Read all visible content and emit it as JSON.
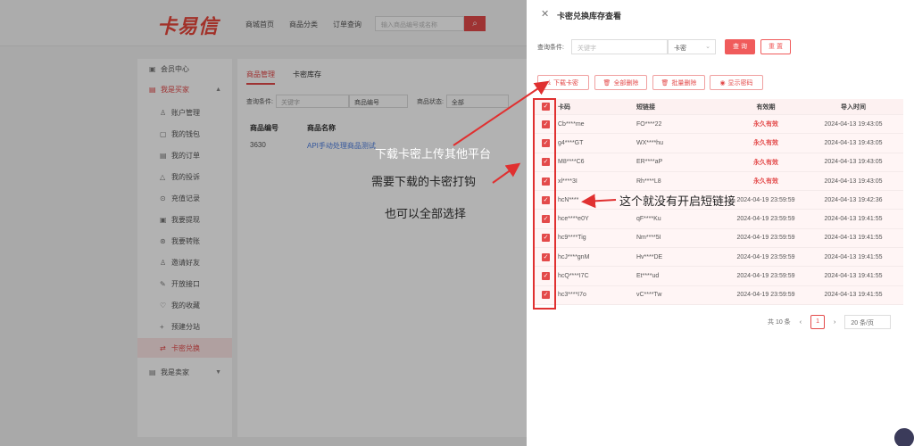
{
  "header": {
    "logo_text": "卡易信",
    "nav": [
      "商城首页",
      "商品分类",
      "订单查询"
    ],
    "search_placeholder": "输入商品编号或名称"
  },
  "sidebar": {
    "items": [
      {
        "label": "会员中心",
        "icon": "home-icon"
      },
      {
        "label": "我是买家",
        "icon": "buyer-icon"
      },
      {
        "label": "账户管理",
        "icon": "user-icon"
      },
      {
        "label": "我的钱包",
        "icon": "wallet-icon"
      },
      {
        "label": "我的订单",
        "icon": "order-icon"
      },
      {
        "label": "我的投诉",
        "icon": "warning-icon"
      },
      {
        "label": "充值记录",
        "icon": "recharge-icon"
      },
      {
        "label": "我要提现",
        "icon": "withdraw-icon"
      },
      {
        "label": "我要转账",
        "icon": "transfer-icon"
      },
      {
        "label": "邀请好友",
        "icon": "invite-icon"
      },
      {
        "label": "开放接口",
        "icon": "api-icon"
      },
      {
        "label": "我的收藏",
        "icon": "heart-icon"
      },
      {
        "label": "预建分站",
        "icon": "plus-icon"
      },
      {
        "label": "卡密兑换",
        "icon": "exchange-icon"
      },
      {
        "label": "我是卖家",
        "icon": "seller-icon"
      }
    ]
  },
  "main": {
    "tabs": [
      "商品管理",
      "卡密库存"
    ],
    "filter_label": "查询条件:",
    "filter_placeholder": "关键字",
    "filter_select": "商品编号",
    "status_label": "商品状态:",
    "status_value": "全部",
    "columns": [
      "商品编号",
      "商品名称"
    ],
    "row": {
      "id": "3630",
      "name": "API手动处理商品测试"
    }
  },
  "drawer": {
    "title": "卡密兑换库存查看",
    "query_label": "查询条件:",
    "query_placeholder": "关键字",
    "query_select": "卡密",
    "btn_query": "查 询",
    "btn_reset": "重 置",
    "actions": [
      {
        "label": "下载卡密",
        "icon": "download-icon"
      },
      {
        "label": "全部删除",
        "icon": "trash-icon"
      },
      {
        "label": "批量删除",
        "icon": "trash-icon"
      },
      {
        "label": "显示密码",
        "icon": "eye-icon"
      }
    ],
    "columns": [
      "卡码",
      "短链接",
      "有效期",
      "导入时间"
    ],
    "rows": [
      {
        "code": "Cb****me",
        "short": "FO****22",
        "valid": "永久有效",
        "time": "2024-04-13 19:43:05"
      },
      {
        "code": "g4****GT",
        "short": "WX****hu",
        "valid": "永久有效",
        "time": "2024-04-13 19:43:05"
      },
      {
        "code": "M8****C6",
        "short": "ER****aP",
        "valid": "永久有效",
        "time": "2024-04-13 19:43:05"
      },
      {
        "code": "xl****3I",
        "short": "Rh****L8",
        "valid": "永久有效",
        "time": "2024-04-13 19:43:05"
      },
      {
        "code": "hcN****",
        "short": "",
        "valid": "2024-04-19 23:59:59",
        "time": "2024-04-13 19:42:36"
      },
      {
        "code": "hce****e0Y",
        "short": "qF****Ku",
        "valid": "2024-04-19 23:59:59",
        "time": "2024-04-13 19:41:55"
      },
      {
        "code": "hc9****Tig",
        "short": "Nm****5I",
        "valid": "2024-04-19 23:59:59",
        "time": "2024-04-13 19:41:55"
      },
      {
        "code": "hcJ****gnM",
        "short": "Hv****DE",
        "valid": "2024-04-19 23:59:59",
        "time": "2024-04-13 19:41:55"
      },
      {
        "code": "hcQ****I7C",
        "short": "Et****ud",
        "valid": "2024-04-19 23:59:59",
        "time": "2024-04-13 19:41:55"
      },
      {
        "code": "hc3****I7o",
        "short": "vC****Tw",
        "valid": "2024-04-19 23:59:59",
        "time": "2024-04-13 19:41:55"
      }
    ],
    "pager": {
      "total": "共 10 条",
      "page": "1",
      "size": "20 条/页"
    }
  },
  "annotations": {
    "download_note": "下载卡密上传其他平台",
    "check_note": "需要下载的卡密打钩",
    "select_all_note": "也可以全部选择",
    "no_short_link_note": "这个就没有开启短链接"
  },
  "colors": {
    "accent": "#e34a4a",
    "annotation": "#e03030"
  }
}
